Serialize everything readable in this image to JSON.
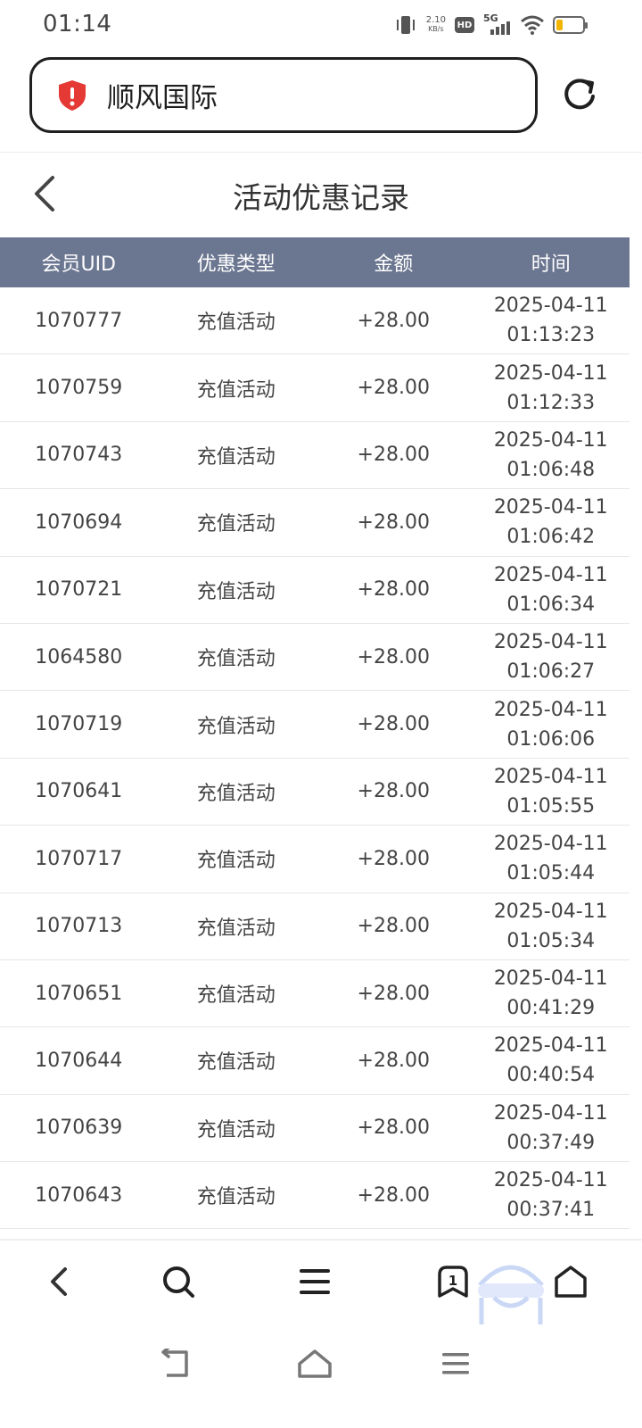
{
  "status_bar": {
    "time": "01:14",
    "net_speed_value": "2.10",
    "net_speed_unit": "KB/s",
    "hd_label": "HD",
    "network_label": "5G",
    "battery_color": "#f2b600",
    "battery_level": 0.25
  },
  "address_bar": {
    "site_name": "顺风国际"
  },
  "header": {
    "title": "活动优惠记录"
  },
  "table": {
    "columns": [
      "会员UID",
      "优惠类型",
      "金额",
      "时间"
    ],
    "rows": [
      {
        "uid": "1070777",
        "type": "充值活动",
        "amount": "+28.00",
        "date": "2025-04-11",
        "time": "01:13:23"
      },
      {
        "uid": "1070759",
        "type": "充值活动",
        "amount": "+28.00",
        "date": "2025-04-11",
        "time": "01:12:33"
      },
      {
        "uid": "1070743",
        "type": "充值活动",
        "amount": "+28.00",
        "date": "2025-04-11",
        "time": "01:06:48"
      },
      {
        "uid": "1070694",
        "type": "充值活动",
        "amount": "+28.00",
        "date": "2025-04-11",
        "time": "01:06:42"
      },
      {
        "uid": "1070721",
        "type": "充值活动",
        "amount": "+28.00",
        "date": "2025-04-11",
        "time": "01:06:34"
      },
      {
        "uid": "1064580",
        "type": "充值活动",
        "amount": "+28.00",
        "date": "2025-04-11",
        "time": "01:06:27"
      },
      {
        "uid": "1070719",
        "type": "充值活动",
        "amount": "+28.00",
        "date": "2025-04-11",
        "time": "01:06:06"
      },
      {
        "uid": "1070641",
        "type": "充值活动",
        "amount": "+28.00",
        "date": "2025-04-11",
        "time": "01:05:55"
      },
      {
        "uid": "1070717",
        "type": "充值活动",
        "amount": "+28.00",
        "date": "2025-04-11",
        "time": "01:05:44"
      },
      {
        "uid": "1070713",
        "type": "充值活动",
        "amount": "+28.00",
        "date": "2025-04-11",
        "time": "01:05:34"
      },
      {
        "uid": "1070651",
        "type": "充值活动",
        "amount": "+28.00",
        "date": "2025-04-11",
        "time": "00:41:29"
      },
      {
        "uid": "1070644",
        "type": "充值活动",
        "amount": "+28.00",
        "date": "2025-04-11",
        "time": "00:40:54"
      },
      {
        "uid": "1070639",
        "type": "充值活动",
        "amount": "+28.00",
        "date": "2025-04-11",
        "time": "00:37:49"
      },
      {
        "uid": "1070643",
        "type": "充值活动",
        "amount": "+28.00",
        "date": "2025-04-11",
        "time": "00:37:41"
      }
    ]
  },
  "browser_toolbar": {
    "tab_count": "1",
    "icons": [
      "back-icon",
      "search-icon",
      "menu-icon",
      "tabs-icon",
      "home-icon"
    ]
  },
  "system_nav": {
    "icons": [
      "return-icon",
      "home-icon",
      "recents-icon"
    ]
  },
  "colors": {
    "table_header_bg": "#6b7690",
    "shield_red": "#e53935"
  }
}
